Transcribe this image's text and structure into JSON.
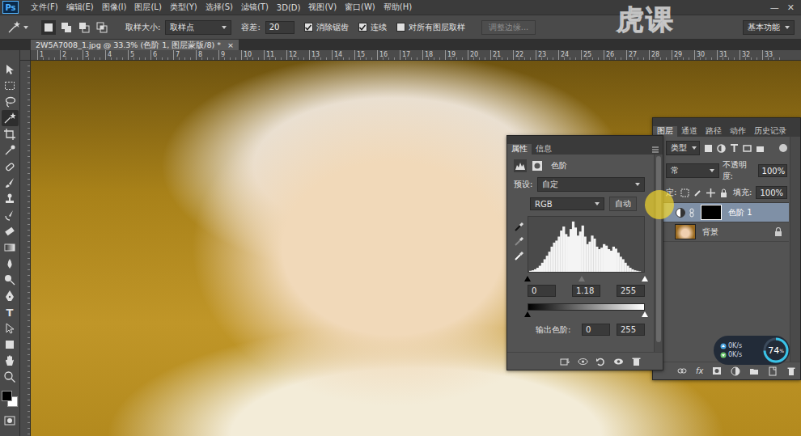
{
  "app": {
    "logo": "Ps"
  },
  "menu": [
    "文件(F)",
    "编辑(E)",
    "图像(I)",
    "图层(L)",
    "类型(Y)",
    "选择(S)",
    "滤镜(T)",
    "3D(D)",
    "视图(V)",
    "窗口(W)",
    "帮助(H)"
  ],
  "window_controls": [
    "—",
    "✕"
  ],
  "watermark": "虎课",
  "options": {
    "sample_size_label": "取样大小:",
    "sample_size": "取样点",
    "tolerance_label": "容差:",
    "tolerance": "20",
    "checkboxes": [
      {
        "label": "消除锯齿",
        "checked": true
      },
      {
        "label": "连续",
        "checked": true
      },
      {
        "label": "对所有图层取样",
        "checked": false
      }
    ],
    "refine_button": {
      "label": "调整边缘...",
      "disabled": true
    },
    "workspace": "基本功能"
  },
  "document_tab": {
    "title": "2W5A7008_1.jpg @ 33.3% (色阶 1, 图层蒙版/8) *",
    "close": "×"
  },
  "ruler_ticks": [
    "1",
    "2",
    "3",
    "4",
    "5",
    "6",
    "7",
    "8",
    "9",
    "10",
    "11",
    "12",
    "13",
    "14",
    "15",
    "16",
    "17",
    "18",
    "19",
    "20",
    "21",
    "22",
    "23",
    "24",
    "25",
    "26",
    "27",
    "28",
    "29",
    "30",
    "31",
    "32",
    "33"
  ],
  "tools": [
    {
      "kind": "move",
      "selected": false
    },
    {
      "kind": "marquee",
      "selected": false
    },
    {
      "kind": "lasso",
      "selected": false
    },
    {
      "kind": "wand",
      "selected": true
    },
    {
      "kind": "crop",
      "selected": false
    },
    {
      "kind": "eyedropper",
      "selected": false
    },
    {
      "kind": "heal",
      "selected": false
    },
    {
      "kind": "brush",
      "selected": false
    },
    {
      "kind": "stamp",
      "selected": false
    },
    {
      "kind": "history",
      "selected": false
    },
    {
      "kind": "eraser",
      "selected": false
    },
    {
      "kind": "gradient",
      "selected": false
    },
    {
      "kind": "blur",
      "selected": false
    },
    {
      "kind": "dodge",
      "selected": false
    },
    {
      "kind": "pen",
      "selected": false
    },
    {
      "kind": "text",
      "glyph": "T",
      "selected": false
    },
    {
      "kind": "path",
      "selected": false
    },
    {
      "kind": "shape",
      "selected": false
    },
    {
      "kind": "hand",
      "selected": false
    },
    {
      "kind": "zoom",
      "selected": false
    }
  ],
  "colors": {
    "foreground": "#000000",
    "background": "#ffffff"
  },
  "properties": {
    "tabs": [
      {
        "label": "属性",
        "selected": true
      },
      {
        "label": "信息",
        "selected": false
      }
    ],
    "title": "色阶",
    "preset_label": "预设:",
    "preset": "自定",
    "channel": "RGB",
    "auto_button": "自动",
    "histogram": [
      0.02,
      0.03,
      0.05,
      0.08,
      0.12,
      0.18,
      0.25,
      0.32,
      0.4,
      0.5,
      0.58,
      0.62,
      0.7,
      0.82,
      0.9,
      0.75,
      0.7,
      0.85,
      1.0,
      0.88,
      0.72,
      0.8,
      0.92,
      0.7,
      0.55,
      0.6,
      0.72,
      0.66,
      0.5,
      0.45,
      0.48,
      0.55,
      0.52,
      0.45,
      0.42,
      0.5,
      0.46,
      0.38,
      0.3,
      0.25,
      0.18,
      0.12,
      0.08,
      0.05,
      0.03,
      0.02,
      0.01,
      0.0
    ],
    "input_handles": [
      {
        "level": 0
      },
      {
        "level": 0.46
      },
      {
        "level": 1
      }
    ],
    "input_values": [
      "0",
      "1.18",
      "255"
    ],
    "output_handles": [
      {
        "level": 0
      },
      {
        "level": 1
      }
    ],
    "output_label": "输出色阶:",
    "output_values": [
      "0",
      "255"
    ]
  },
  "layers": {
    "tabs": [
      {
        "label": "图层",
        "selected": true
      },
      {
        "label": "通道",
        "selected": false
      },
      {
        "label": "路径",
        "selected": false
      },
      {
        "label": "动作",
        "selected": false
      },
      {
        "label": "历史记录",
        "selected": false
      }
    ],
    "filter": "类型",
    "blend_mode": "常",
    "opacity_label": "不透明度:",
    "opacity": "100%",
    "lock_label": "定:",
    "fill_label": "填充:",
    "fill": "100%",
    "items": [
      {
        "name": "色阶 1",
        "kind": "adjustment",
        "selected": true,
        "locked": false
      },
      {
        "name": "背景",
        "kind": "image",
        "selected": false,
        "locked": true
      }
    ],
    "fx": "fx"
  },
  "network": {
    "upload": "0K/s",
    "download": "0K/s",
    "percent": "74",
    "unit": "%",
    "level": 0.74
  }
}
